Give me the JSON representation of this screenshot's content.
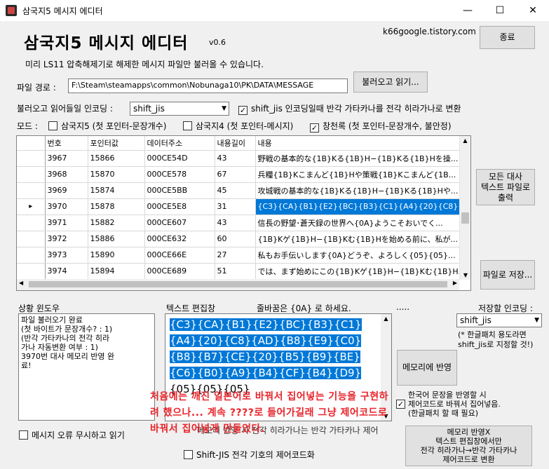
{
  "window": {
    "title": "삼국지5 메시지 에디터",
    "minimize": "—",
    "maximize": "☐",
    "close": "✕"
  },
  "header": {
    "title": "삼국지5 메시지 에디터",
    "version": "v0.6",
    "site": "k66google.tistory.com",
    "exit_button": "종료"
  },
  "notice": "미리 LS11 압축해제기로 해제한 메시지 파일만 불러올 수 있습니다.",
  "file": {
    "label": "파일 경로 :",
    "path": "F:\\Steam\\steamapps\\common\\Nobunaga10\\PK\\DATA\\MESSAGE",
    "load_button": "불러오고 읽기..."
  },
  "encoding": {
    "label": "불러오고 읽어들일 인코딩 :",
    "value": "shift_jis",
    "kana_option": "shift_jis 인코딩일때 반각 가타카나를 전각 히라가나로 변환",
    "kana_checked": true
  },
  "mode": {
    "label": "모드 :",
    "options": [
      {
        "label": "삼국지5 (첫 포인터-문장개수)",
        "checked": false
      },
      {
        "label": "삼국지4 (첫 포인터-메시지)",
        "checked": false
      },
      {
        "label": "창천록 (첫 포인터-문장개수, 불안정)",
        "checked": true
      }
    ]
  },
  "grid": {
    "columns": [
      "번호",
      "포인터값",
      "데이터주소",
      "내용길이",
      "내용"
    ],
    "rows": [
      {
        "num": "3967",
        "ptr": "15866",
        "addr": "000CE54D",
        "len": "43",
        "content": "野戦の基本的な{1B}Kる{1B}H−{1B}Kる{1B}Hを操..."
      },
      {
        "num": "3968",
        "ptr": "15870",
        "addr": "000CE578",
        "len": "67",
        "content": "兵糧{1B}Kこまんど{1B}Hや策戦{1B}Kこまんど{1B..."
      },
      {
        "num": "3969",
        "ptr": "15874",
        "addr": "000CE5BB",
        "len": "45",
        "content": "攻城戦の基本的な{1B}Kる{1B}H−{1B}Kる{1B}Hや..."
      },
      {
        "num": "3970",
        "ptr": "15878",
        "addr": "000CE5E8",
        "len": "31",
        "content": "{C3}{CA}{B1}{E2}{BC}{B3}{C1}{A4}{20}{C8}{A...",
        "selected": true
      },
      {
        "num": "3971",
        "ptr": "15882",
        "addr": "000CE607",
        "len": "43",
        "content": "信長の野望･蒼天録の世界へ{0A}ようこそおいでく..."
      },
      {
        "num": "3972",
        "ptr": "15886",
        "addr": "000CE632",
        "len": "60",
        "content": "{1B}Kゲ{1B}H−{1B}Kむ{1B}Hを始める前に、私が..."
      },
      {
        "num": "3973",
        "ptr": "15890",
        "addr": "000CE66E",
        "len": "27",
        "content": "私もお手伝いします{0A}どうぞ、よろしく{05}{05}..."
      },
      {
        "num": "3974",
        "ptr": "15894",
        "addr": "000CE689",
        "len": "51",
        "content": "では、まず始めにこの{1B}Kゲ{1B}H−{1B}Kむ{1B}H..."
      }
    ]
  },
  "side": {
    "export_all": "모든 대사\n텍스트 파일로\n출력",
    "save_file": "파일로 저장..."
  },
  "status": {
    "label": "상황 윈도우",
    "text": "파일 불러오기 완료\n(첫 바이트가 문장개수? : 1)\n(반각 가타카나의 전각 히라\n가나 자동변환 여부 : 1)\n3970번 대사 메모리 반영 완\n료!"
  },
  "editor": {
    "label": "텍스트 편집창",
    "hint": "줄바꿈은 {0A} 로 하세요.",
    "dots": ".....",
    "selected_text": "{C3}{CA}{B1}{E2}{BC}{B3}{C1}{A4}{20}{C8}{AD}{B8}{E9}{C0}{B8}{B7}{CE}{20}{B5}{B9}{BE}{C6}{B0}{A9}{B4}{CF}{B4}{D9}",
    "rest_text": "{05}{05}{05}"
  },
  "save_encoding": {
    "label": "저장할 인코딩 :",
    "value": "shift_jis",
    "note": "(* 한글패치 용도라면\nshift_jis로 지정할 것!)"
  },
  "memory_apply": "메모리에 반영",
  "korean_option": "한국어 문장을 반영할 시\n제어코드로 바꿔서 집어넣음.\n(한글패치 할 때 필요)",
  "memory_apply_convert": "메모리 반영X\n텍스트 편집창에서만\n전각 히라가나→반각 가타카나\n제어코드로 변환",
  "bottom_options": {
    "ignore_errors": "메시지 오류 무시하고 읽기",
    "hidden_option": "메모리 반영 시 전각 히라가나는 반각 가타카나 제어",
    "sjis_codes": "Shift-JIS 전각 기호의 제어코드화"
  },
  "overlay_text": "처음에는 깨진 일본어로 바꿔서 집어넣는 기능을 구현하려 했으나... 계속 ????로 들어가길래 그냥 제어코드로 바꿔서 집어넣게 만들었다."
}
